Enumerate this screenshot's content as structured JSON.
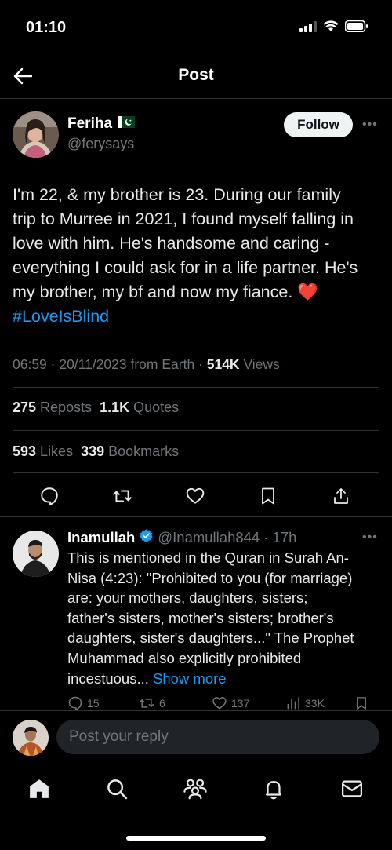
{
  "status_bar": {
    "time": "01:10"
  },
  "header": {
    "title": "Post"
  },
  "post": {
    "author_name": "Feriha",
    "author_flag": "🇵🇰",
    "author_handle": "@ferysays",
    "follow_label": "Follow",
    "text_lines": [
      "I'm 22, & my brother is 23. During our family",
      "trip to Murree in 2021, I found myself falling in",
      "love with him. He's handsome and caring -",
      "everything I could ask for in a life partner. He's",
      "my brother, my bf and now my fiance."
    ],
    "heart_emoji": "❤️",
    "hashtag": "#LoveIsBlind",
    "timestamp": "06:59 · 20/11/2023 from Earth · ",
    "views_count": "514K",
    "views_label": " Views",
    "reposts_count": "275",
    "reposts_label": " Reposts",
    "quotes_count": "1.1K",
    "quotes_label": " Quotes",
    "likes_count": "593",
    "likes_label": " Likes",
    "bookmarks_count": "339",
    "bookmarks_label": " Bookmarks"
  },
  "reply": {
    "name": "Inamullah",
    "handle": "@Inamullah844",
    "time": "· 17h",
    "text_lines": [
      "This is mentioned in the Quran in Surah An-",
      "Nisa (4:23): \"Prohibited to you (for marriage)",
      "are: your mothers, daughters, sisters;",
      "father's sisters, mother's sisters; brother's",
      "daughters, sister's daughters...\" The Prophet",
      "Muhammad also explicitly prohibited",
      "incestuous..."
    ],
    "show_more": "Show more",
    "replies": "15",
    "reposts": "6",
    "likes": "137",
    "views": "33K"
  },
  "compose": {
    "placeholder": "Post your reply"
  },
  "colors": {
    "accent": "#1d9bf0",
    "verified": "#1d9bf0",
    "heart": "#e0245e"
  }
}
